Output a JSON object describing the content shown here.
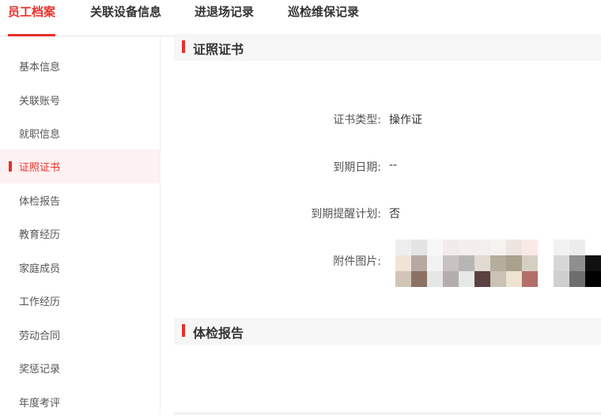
{
  "tabs": [
    {
      "label": "员工档案",
      "active": true
    },
    {
      "label": "关联设备信息",
      "active": false
    },
    {
      "label": "进退场记录",
      "active": false
    },
    {
      "label": "巡检维保记录",
      "active": false
    }
  ],
  "sidebar": {
    "items": [
      {
        "label": "基本信息"
      },
      {
        "label": "关联账号"
      },
      {
        "label": "就职信息"
      },
      {
        "label": "证照证书",
        "active": true
      },
      {
        "label": "体检报告"
      },
      {
        "label": "教育经历"
      },
      {
        "label": "家庭成员"
      },
      {
        "label": "工作经历"
      },
      {
        "label": "劳动合同"
      },
      {
        "label": "奖惩记录"
      },
      {
        "label": "年度考评"
      }
    ]
  },
  "sections": {
    "certificate": {
      "title": "证照证书",
      "fields": [
        {
          "label": "证书类型:",
          "value": "操作证"
        },
        {
          "label": "到期日期:",
          "value": "--"
        },
        {
          "label": "到期提醒计划:",
          "value": "否"
        },
        {
          "label": "附件图片:",
          "value": ""
        }
      ]
    },
    "physical": {
      "title": "体检报告"
    }
  },
  "colors": {
    "accent": "#e8302a",
    "active_bg": "#fdf1f1",
    "section_bg": "#f6f6f6"
  },
  "icons": {
    "attachment_thumbnails": [
      "blurred-image-thumbnail",
      "blurred-image-thumbnail",
      "blurred-image-thumbnail"
    ]
  }
}
